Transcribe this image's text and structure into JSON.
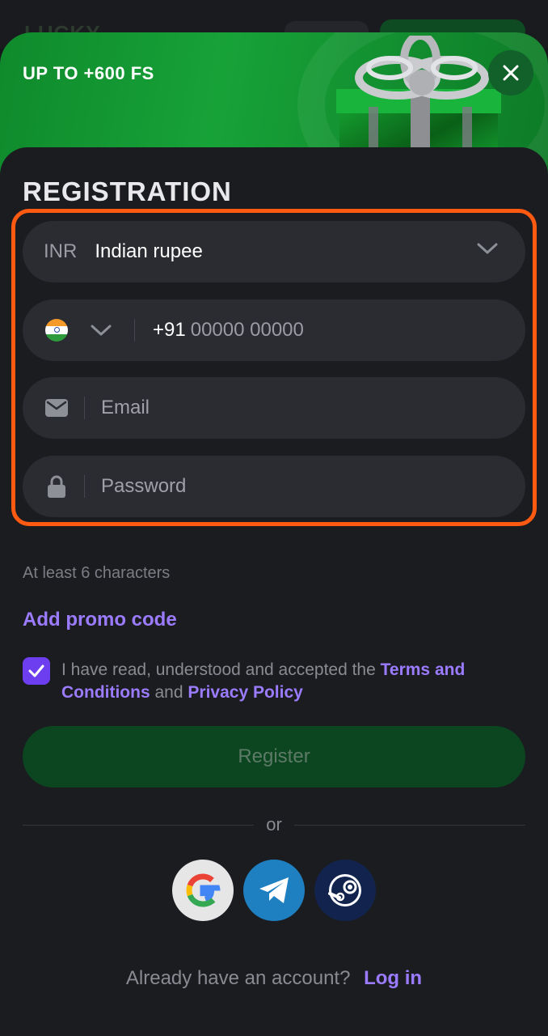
{
  "background": {
    "logo_text": "LUCKY"
  },
  "banner": {
    "title": "UP TO +600 FS"
  },
  "form": {
    "title": "REGISTRATION",
    "currency": {
      "code": "INR",
      "name": "Indian rupee"
    },
    "phone": {
      "prefix": "+91",
      "placeholder": "00000 00000"
    },
    "email": {
      "placeholder": "Email"
    },
    "password": {
      "placeholder": "Password",
      "hint": "At least 6 characters"
    },
    "promo_label": "Add promo code",
    "terms": {
      "text_before": "I have read, understood and accepted the",
      "terms_link": "Terms and Conditions",
      "and": "and",
      "privacy_link": "Privacy Policy"
    },
    "register_label": "Register",
    "or_label": "or",
    "login_prompt": "Already have an account?",
    "login_link": "Log in"
  },
  "social": [
    "google-icon",
    "telegram-icon",
    "steam-icon"
  ],
  "colors": {
    "accent_purple": "#9b7bff",
    "highlight_orange": "#ff5a12",
    "banner_green": "#17a238",
    "register_green": "#0b4620"
  }
}
